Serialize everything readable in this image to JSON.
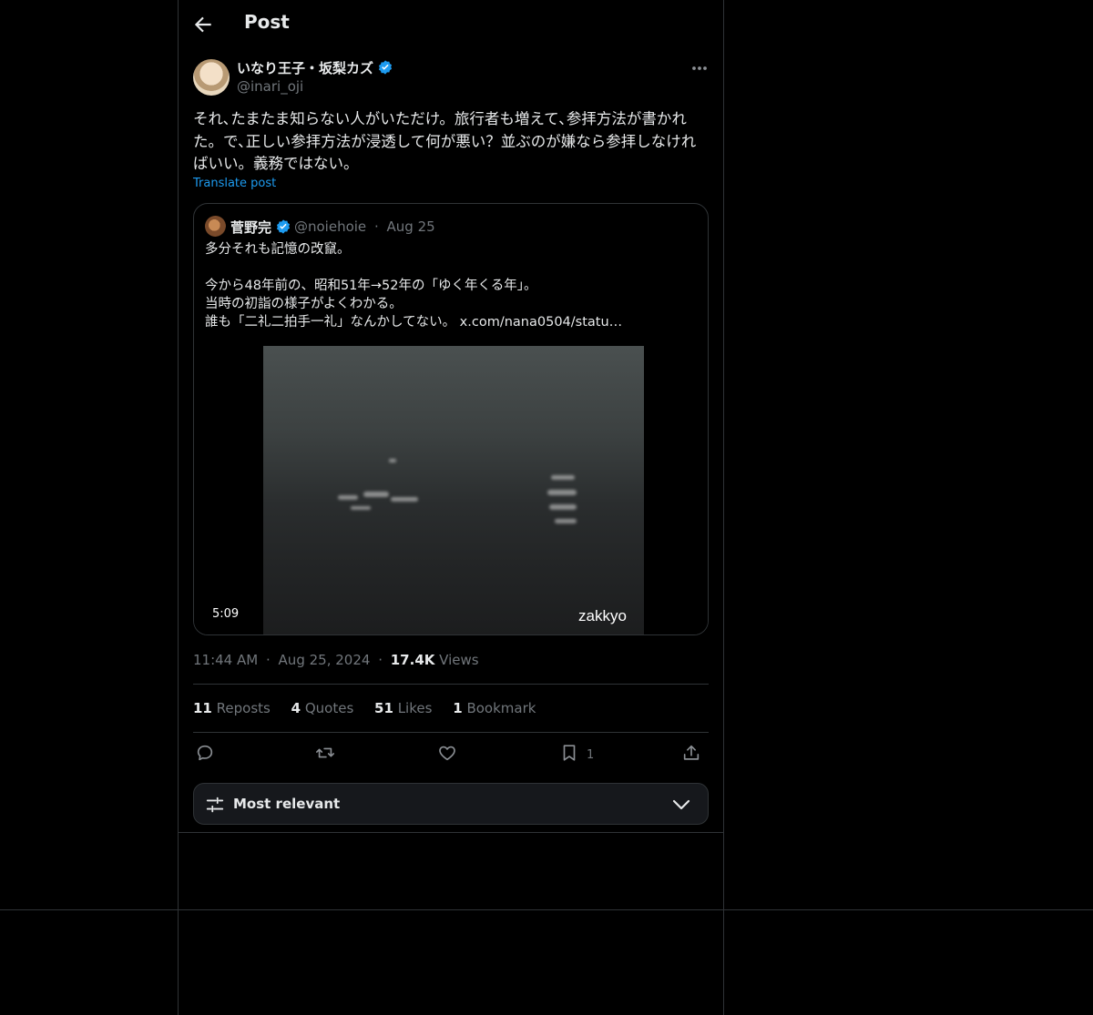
{
  "header": {
    "title": "Post"
  },
  "post": {
    "author_name": "いなり王子・坂梨カズ",
    "author_handle": "@inari_oji",
    "text": "それ､たまたま知らない人がいただけ。旅行者も増えて､参拝方法が書かれた。で､正しい参拝方法が浸透して何が悪い？並ぶのが嫌なら参拝しなければいい。義務ではない。",
    "translate_label": "Translate post",
    "time": "11:44 AM",
    "date": "Aug 25, 2024",
    "views_count": "17.4K",
    "views_label": "Views"
  },
  "quote": {
    "author_name": "菅野完",
    "author_handle": "@noiehoie",
    "separator": "·",
    "date": "Aug 25",
    "text": "多分それも記憶の改竄。\n\n今から48年前の、昭和51年→52年の「ゆく年くる年」。\n当時の初詣の様子がよくわかる。\n誰も「二礼二拍手一礼」なんかしてない。 x.com/nana0504/statu…",
    "video_duration": "5:09",
    "watermark": "zakkyo"
  },
  "stats": {
    "reposts_count": "11",
    "reposts_label": "Reposts",
    "quotes_count": "4",
    "quotes_label": "Quotes",
    "likes_count": "51",
    "likes_label": "Likes",
    "bookmarks_count": "1",
    "bookmarks_label": "Bookmark"
  },
  "actions": {
    "bookmark_count": "1"
  },
  "sort": {
    "label": "Most relevant"
  },
  "colors": {
    "accent": "#1d9bf0",
    "background": "#000000",
    "border": "#2f3336",
    "muted": "#71767b",
    "text": "#e7e9ea"
  },
  "icons": [
    "back-arrow-icon",
    "verified-badge-icon",
    "more-options-icon",
    "reply-icon",
    "repost-icon",
    "like-icon",
    "bookmark-icon",
    "share-icon",
    "filter-sliders-icon",
    "chevron-down-icon"
  ]
}
